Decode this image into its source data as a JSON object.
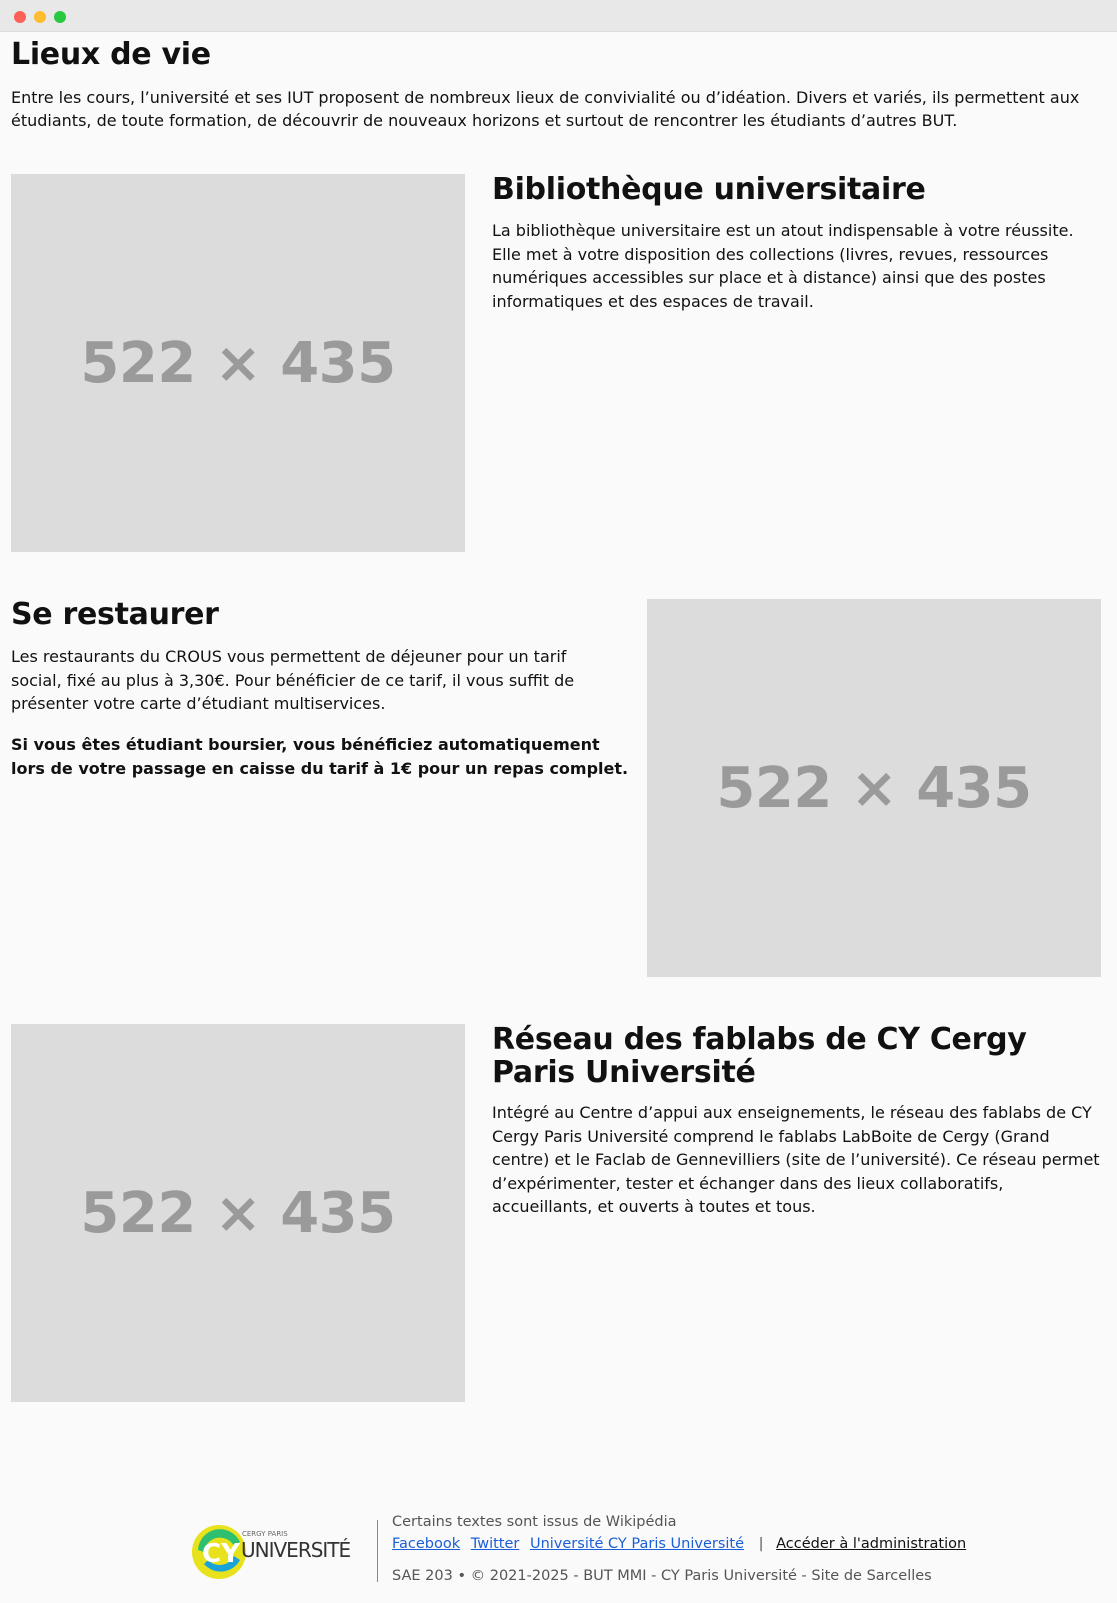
{
  "page": {
    "title": "Lieux de vie",
    "intro": "Entre les cours, l’université et ses IUT proposent de nombreux lieux de convivialité ou d’idéation. Divers et variés, ils permettent aux étudiants, de toute formation, de découvrir de nouveaux horizons et surtout de rencontrer les étudiants d’autres BUT."
  },
  "sections": [
    {
      "title": "Bibliothèque universitaire",
      "paragraphs": [
        "La bibliothèque universitaire est un atout indispensable à votre réussite. Elle met à votre disposition des collections (livres, revues, ressources numériques accessibles sur place et à distance) ainsi que des postes informatiques et des espaces de travail."
      ],
      "image_label": "522 × 435"
    },
    {
      "title": "Se restaurer",
      "paragraphs": [
        "Les restaurants du CROUS vous permettent de déjeuner pour un tarif social, fixé au plus à 3,30€. Pour bénéficier de ce tarif, il vous suffit de présenter votre carte d’étudiant multiservices.",
        "Si vous êtes étudiant boursier, vous bénéficiez automatiquement lors de votre passage en caisse du tarif à 1€ pour un repas complet."
      ],
      "image_label": "522 × 435"
    },
    {
      "title": "Réseau des fablabs de CY Cergy Paris Université",
      "paragraphs": [
        "Intégré au Centre d’appui aux enseignements, le réseau des fablabs de CY Cergy Paris Université comprend le fablabs LabBoite de Cergy (Grand centre) et le Faclab de Gennevilliers (site de l’université). Ce réseau permet d’expérimenter, tester et échanger dans des lieux collaboratifs, accueillants, et ouverts à toutes et tous."
      ],
      "image_label": "522 × 435"
    }
  ],
  "footer": {
    "logo": {
      "small_text": "CERGY PARIS",
      "main_text": "UNIVERSITÉ",
      "mark": "CY",
      "colors": {
        "yellow": "#e8e21c",
        "green": "#2fbf71",
        "blue": "#1aa3d9"
      }
    },
    "credit": "Certains textes sont issus de Wikipédia",
    "links": [
      {
        "label": "Facebook"
      },
      {
        "label": "Twitter"
      },
      {
        "label": "Université CY Paris Université"
      }
    ],
    "separator": "|",
    "admin_link": "Accéder à l'administration",
    "copyright": "SAE 203 • © 2021-2025 - BUT MMI - CY Paris Université - Site de Sarcelles"
  },
  "colors": {
    "link": "#1a5fd6",
    "placeholder_bg": "#dcdcdc",
    "placeholder_text": "#9a9a9a"
  }
}
